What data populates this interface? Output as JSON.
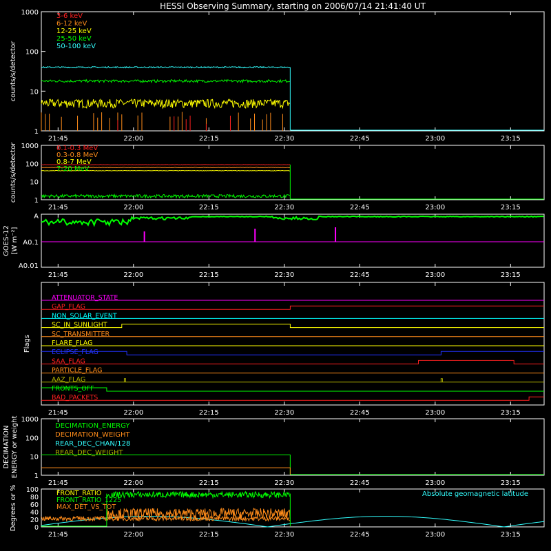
{
  "title": "HESSI Observing Summary, starting on 2006/07/14 21:41:40 UT",
  "time_ticks": [
    "21:45",
    "22:00",
    "22:15",
    "22:30",
    "22:45",
    "23:00",
    "23:15"
  ],
  "time_tick_minutes": [
    3.33,
    18.33,
    33.33,
    48.33,
    63.33,
    78.33,
    93.33
  ],
  "time_range_minutes": [
    0,
    100
  ],
  "panels": {
    "lowe": {
      "ylabel": "counts/s/detector",
      "yticks": [
        "1",
        "10",
        "100",
        "1000"
      ],
      "legend": [
        {
          "label": "3-6 keV",
          "color": "#ff2020"
        },
        {
          "label": "6-12 keV",
          "color": "#ff8c1a"
        },
        {
          "label": "12-25 keV",
          "color": "#ffff00"
        },
        {
          "label": "25-50 keV",
          "color": "#00ff00"
        },
        {
          "label": "50-100 keV",
          "color": "#33ffff"
        }
      ]
    },
    "highe": {
      "ylabel": "counts/s/detector",
      "yticks": [
        "1",
        "10",
        "100",
        "1000"
      ],
      "legend": [
        {
          "label": "0.1-0.3 MeV",
          "color": "#ff2020"
        },
        {
          "label": "0.3-0.8 MeV",
          "color": "#ff8c1a"
        },
        {
          "label": "0.8-7 MeV",
          "color": "#ffff00"
        },
        {
          "label": "7-20 MeV",
          "color": "#00ff00"
        }
      ]
    },
    "goes": {
      "ylabel_top": "GOES-12",
      "ylabel_bottom": "[W m⁻²]",
      "yticks": [
        "A0.01",
        "A0.1",
        "A"
      ]
    },
    "flags": {
      "ylabel": "Flags",
      "items": [
        {
          "label": "ATTENUATOR_STATE",
          "color": "#ff00ff"
        },
        {
          "label": "GAP_FLAG",
          "color": "#ff2020"
        },
        {
          "label": "NON_SOLAR_EVENT",
          "color": "#00ffff"
        },
        {
          "label": "SC_IN_SUNLIGHT",
          "color": "#ffff00"
        },
        {
          "label": "SC_TRANSMITTER",
          "color": "#ff8c1a"
        },
        {
          "label": "FLARE_FLAG",
          "color": "#ffff00"
        },
        {
          "label": "ECLIPSE_FLAG",
          "color": "#2233ff"
        },
        {
          "label": "SAA_FLAG",
          "color": "#ff2020"
        },
        {
          "label": "PARTICLE_FLAG",
          "color": "#ff8c1a"
        },
        {
          "label": "AAZ_FLAG",
          "color": "#b0b000"
        },
        {
          "label": "FRONTS_OFF",
          "color": "#00ff00"
        },
        {
          "label": "BAD_PACKETS",
          "color": "#ff2020"
        }
      ]
    },
    "decim": {
      "ylabel_top": "DECIMATION",
      "ylabel_bottom": "ENERGY or weight",
      "yticks": [
        "1",
        "10",
        "100",
        "1000"
      ],
      "legend": [
        {
          "label": "DECIMATION_ENERGY",
          "color": "#00ff00"
        },
        {
          "label": "DECIMATION_WEIGHT",
          "color": "#ff8c1a"
        },
        {
          "label": "REAR_DEC_CHAN/128",
          "color": "#33ffff"
        },
        {
          "label": "REAR_DEC_WEIGHT",
          "color": "#b0b000"
        }
      ]
    },
    "ratio": {
      "ylabel": "Degrees or %",
      "yticks": [
        "0",
        "20",
        "40",
        "60",
        "80",
        "100"
      ],
      "legend": [
        {
          "label": "FRONT_RATIO",
          "color": "#ffff00"
        },
        {
          "label": "FRONT_RATIO_1225",
          "color": "#00ff00"
        },
        {
          "label": "MAX_DET_VS_TOT",
          "color": "#ff8c1a"
        }
      ],
      "right_label": "Absolute geomagnetic latitude",
      "right_label_color": "#33ffff"
    }
  },
  "chart_data": {
    "type": "line",
    "x_unit": "minutes after 21:41:40 UT",
    "data_end_minute": 49.5,
    "lowe_series": [
      {
        "name": "50-100 keV",
        "level": 40
      },
      {
        "name": "25-50 keV",
        "level": 18
      },
      {
        "name": "12-25 keV",
        "level": 5
      },
      {
        "name": "6-12 keV",
        "level": 1.2
      },
      {
        "name": "3-6 keV",
        "level": 1.1
      }
    ],
    "highe_series": [
      {
        "name": "0.1-0.3 MeV",
        "level": 80
      },
      {
        "name": "0.3-0.8 MeV",
        "level": 60
      },
      {
        "name": "0.8-7 MeV",
        "level": 40
      },
      {
        "name": "7-20 MeV",
        "level": 1.5
      }
    ],
    "flag_transitions": [
      {
        "name": "GAP_FLAG",
        "steps": [
          [
            0,
            0
          ],
          [
            49.5,
            1
          ]
        ]
      },
      {
        "name": "SC_IN_SUNLIGHT",
        "steps": [
          [
            0,
            0
          ],
          [
            16,
            1
          ],
          [
            49.5,
            0
          ]
        ]
      },
      {
        "name": "ECLIPSE_FLAG",
        "steps": [
          [
            0,
            1
          ],
          [
            17,
            0
          ],
          [
            79.5,
            1
          ]
        ]
      },
      {
        "name": "SAA_FLAG",
        "steps": [
          [
            0,
            0
          ],
          [
            75,
            1
          ],
          [
            94,
            0
          ]
        ]
      },
      {
        "name": "FRONTS_OFF",
        "steps": [
          [
            0,
            1
          ],
          [
            13,
            0
          ]
        ]
      },
      {
        "name": "BAD_PACKETS",
        "steps": [
          [
            0,
            0
          ],
          [
            97,
            1
          ]
        ]
      }
    ]
  }
}
